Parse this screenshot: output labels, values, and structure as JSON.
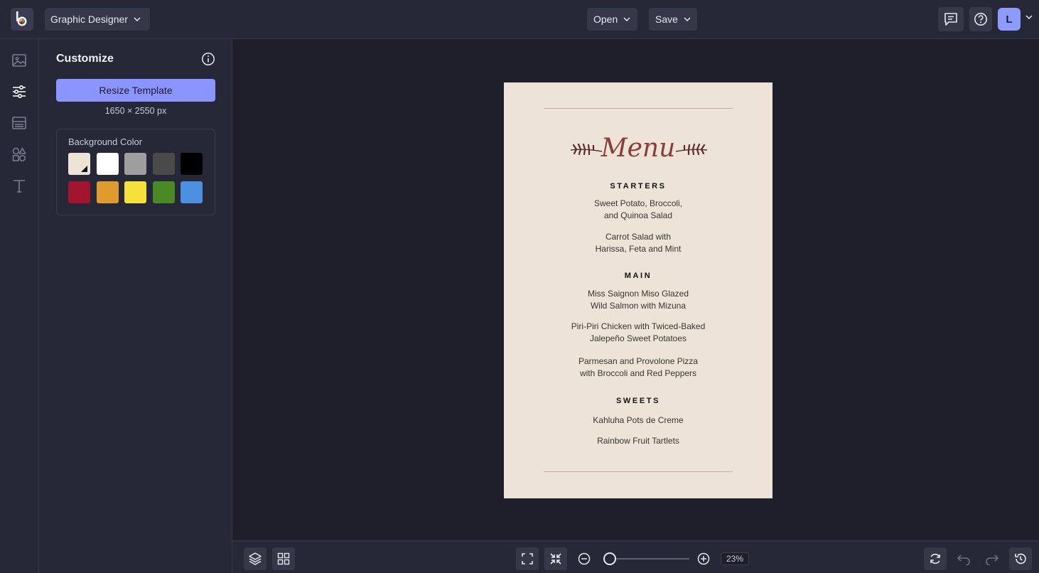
{
  "topbar": {
    "mode_label": "Graphic Designer",
    "open_label": "Open",
    "save_label": "Save",
    "avatar_initial": "L"
  },
  "rail": {
    "items": [
      {
        "icon": "image-icon"
      },
      {
        "icon": "sliders-icon",
        "active": true
      },
      {
        "icon": "layout-icon"
      },
      {
        "icon": "shapes-icon"
      },
      {
        "icon": "text-icon"
      }
    ]
  },
  "panel": {
    "title": "Customize",
    "resize_label": "Resize Template",
    "dimensions": "1650 × 2550 px",
    "bg_label": "Background Color",
    "swatches": [
      "#ede3d6",
      "#ffffff",
      "#9e9e9e",
      "#4a4a4a",
      "#000000",
      "#a3142f",
      "#e09b2d",
      "#f6e13b",
      "#4a8a25",
      "#4a8fe0"
    ]
  },
  "document": {
    "title": "Menu",
    "sections": [
      {
        "heading": "STARTERS",
        "items": [
          [
            "Sweet Potato, Broccoli,",
            "and Quinoa Salad"
          ],
          [
            "Carrot Salad  with",
            "Harissa, Feta and Mint"
          ]
        ]
      },
      {
        "heading": "MAIN",
        "items": [
          [
            "Miss Saignon Miso Glazed",
            "Wild Salmon with Mizuna"
          ],
          [
            "Piri-Piri Chicken with Twiced-Baked",
            "Jalepeño Sweet Potatoes"
          ],
          [
            "Parmesan and Provolone Pizza",
            "with Broccoli and Red Peppers"
          ]
        ]
      },
      {
        "heading": "SWEETS",
        "items": [
          [
            "Kahluha Pots de Creme"
          ],
          [
            "Rainbow Fruit Tartlets"
          ]
        ]
      }
    ]
  },
  "bottombar": {
    "zoom_value": "23%",
    "zoom_fraction": 0.05
  }
}
